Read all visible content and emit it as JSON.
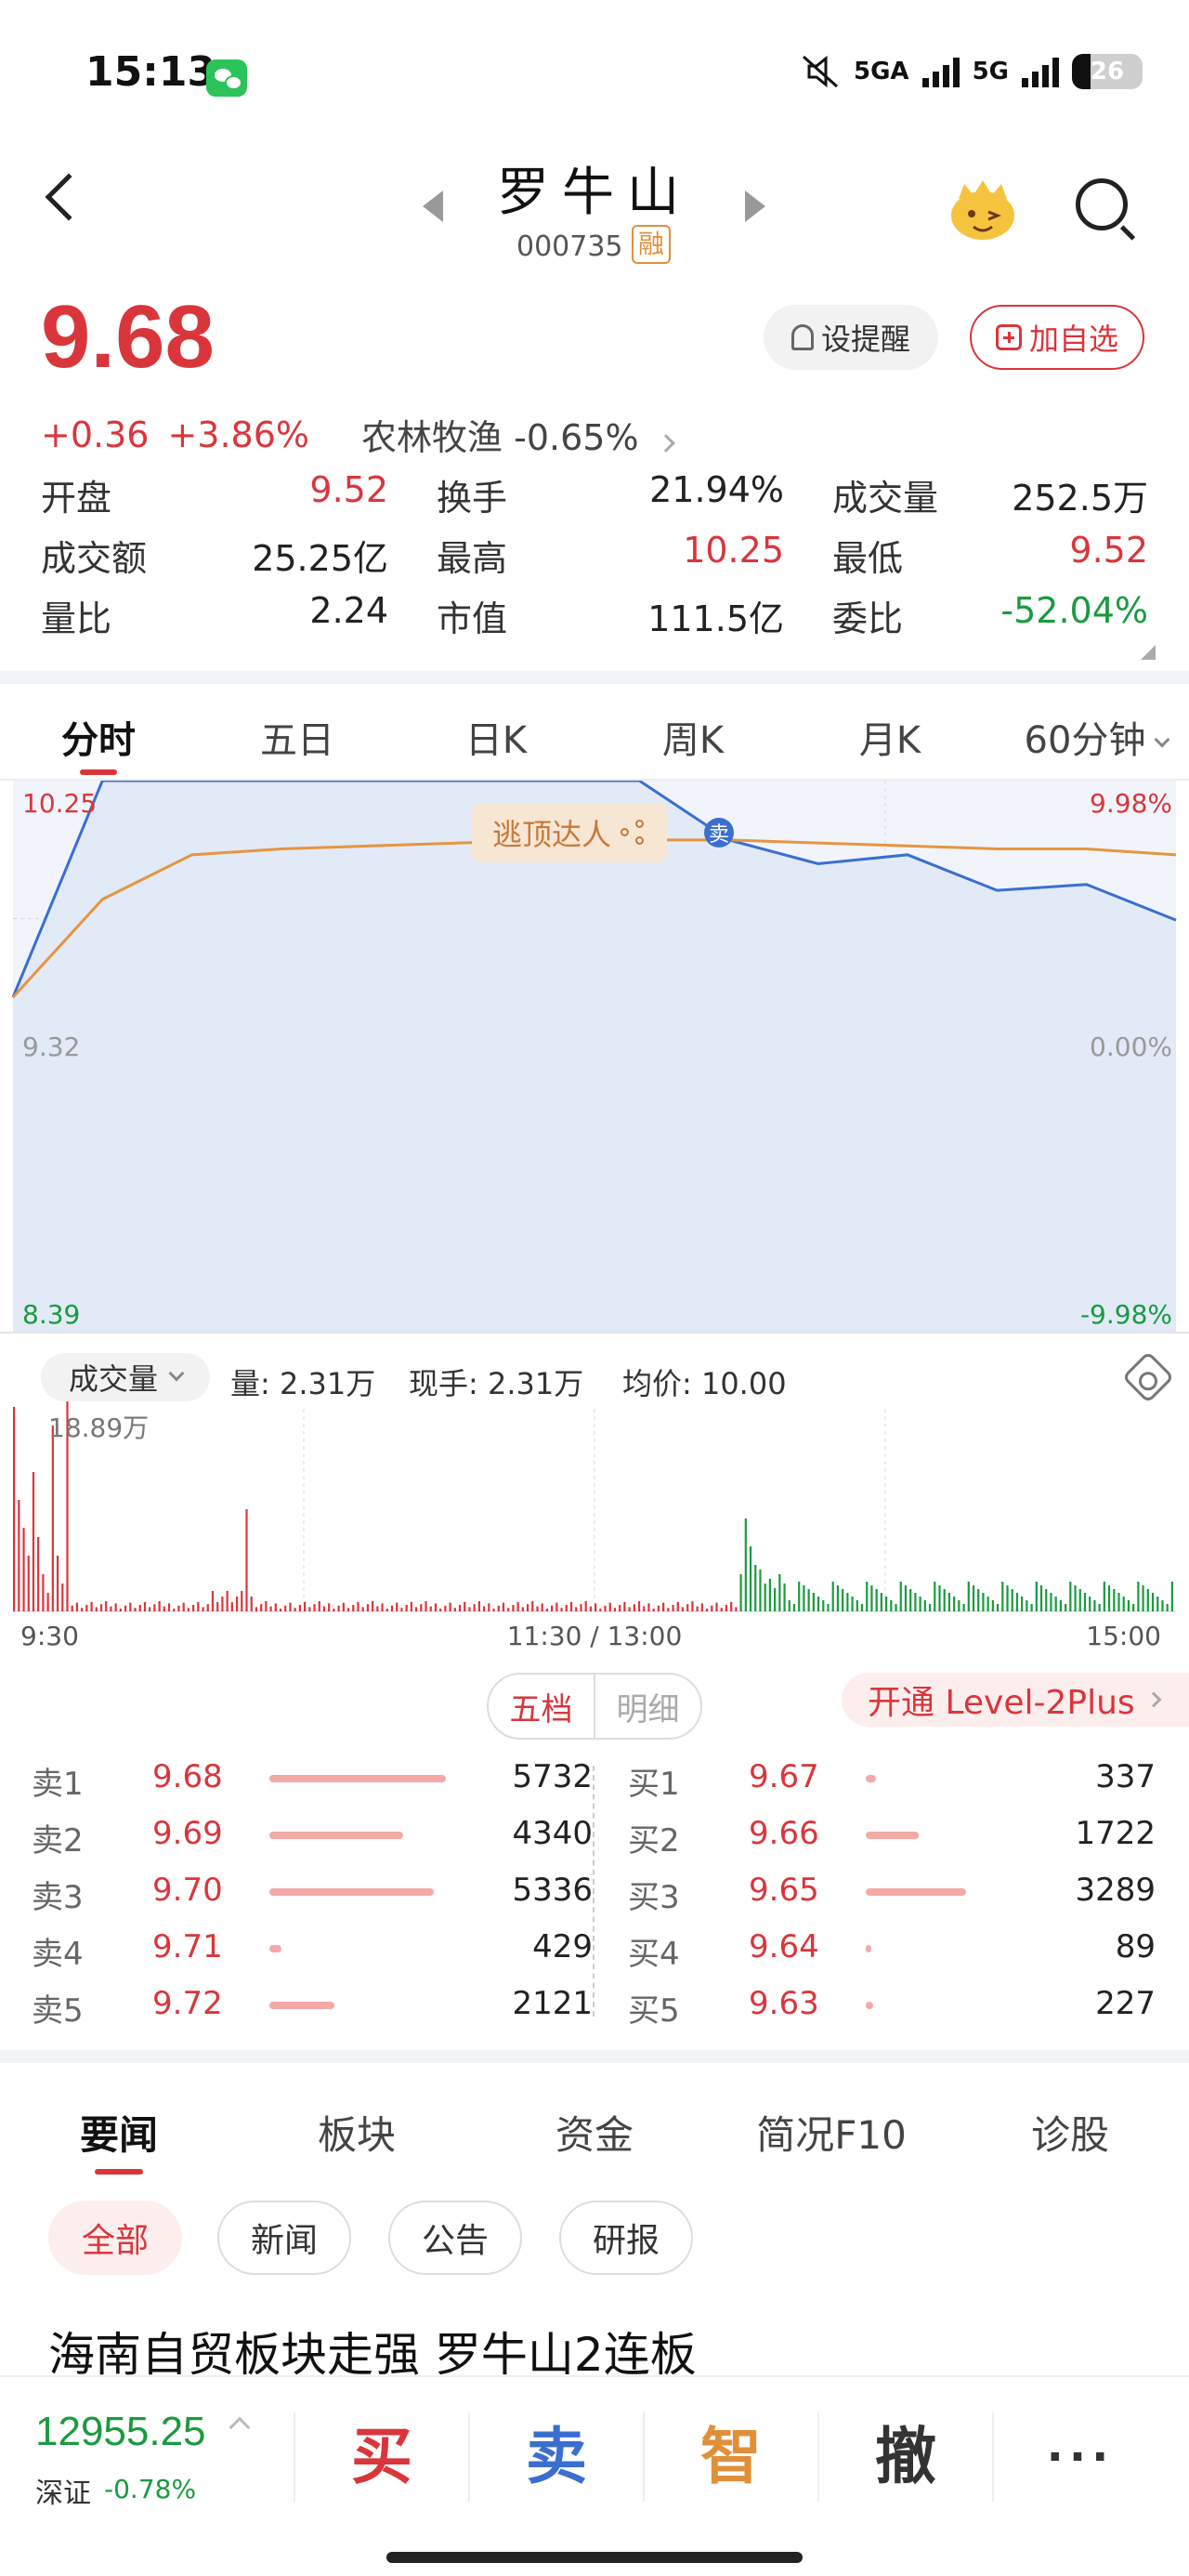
{
  "status_bar": {
    "time": "15:13",
    "network1": "5GA",
    "network2": "5G",
    "battery": "26"
  },
  "header": {
    "stock_name": "罗牛山",
    "stock_code": "000735",
    "margin_badge": "融"
  },
  "quote": {
    "price": "9.68",
    "change": "+0.36",
    "change_pct": "+3.86%",
    "sector_name": "农林牧渔",
    "sector_change": "-0.65%",
    "alert_label": "设提醒",
    "watchlist_label": "加自选",
    "stats": [
      [
        {
          "label": "开盘",
          "value": "9.52",
          "color": "red"
        },
        {
          "label": "换手",
          "value": "21.94%",
          "color": "black"
        },
        {
          "label": "成交量",
          "value": "252.5万",
          "color": "black"
        }
      ],
      [
        {
          "label": "成交额",
          "value": "25.25亿",
          "color": "black"
        },
        {
          "label": "最高",
          "value": "10.25",
          "color": "red"
        },
        {
          "label": "最低",
          "value": "9.52",
          "color": "red"
        }
      ],
      [
        {
          "label": "量比",
          "value": "2.24",
          "color": "black"
        },
        {
          "label": "市值",
          "value": "111.5亿",
          "color": "black"
        },
        {
          "label": "委比",
          "value": "-52.04%",
          "color": "green"
        }
      ]
    ]
  },
  "period_tabs": [
    "分时",
    "五日",
    "日K",
    "周K",
    "月K",
    "60分钟"
  ],
  "chart": {
    "price_high_label": "10.25",
    "price_mid_label": "9.32",
    "price_low_label": "8.39",
    "pct_high_label": "9.98%",
    "pct_mid_label": "0.00%",
    "pct_low_label": "-9.98%",
    "escape_tag": "逃顶达人",
    "sell_marker": "卖",
    "volume_selector": "成交量",
    "volume_text": "量: 2.31万",
    "current_hand": "现手: 2.31万",
    "avg_price": "均价: 10.00",
    "volume_max_label": "18.89万",
    "time_start": "9:30",
    "time_mid": "11:30 / 13:00",
    "time_end": "15:00",
    "colors": {
      "price_line": "#3a6fd0",
      "avg_line": "#e6953e",
      "up": "#d9363b",
      "down": "#1a9a3f"
    }
  },
  "chart_data": {
    "type": "line",
    "title": "",
    "xlabel": "",
    "ylabel": "",
    "ylim": [
      8.39,
      10.25
    ],
    "x": [
      "9:30",
      "9:35",
      "9:40",
      "10:00",
      "10:30",
      "11:00",
      "11:30/13:00",
      "13:10",
      "13:20",
      "13:40",
      "14:00",
      "14:20",
      "14:40",
      "15:00"
    ],
    "series": [
      {
        "values": [
          9.52,
          10.25,
          10.25,
          10.25,
          10.25,
          10.25,
          10.25,
          10.25,
          10.05,
          9.97,
          10.0,
          9.88,
          9.9,
          9.78
        ]
      },
      {
        "values": [
          9.52,
          9.85,
          10.0,
          10.02,
          10.03,
          10.04,
          10.05,
          10.05,
          10.05,
          10.04,
          10.03,
          10.02,
          10.02,
          10.0
        ]
      }
    ]
  },
  "orderbook": {
    "toggle_on": "五档",
    "toggle_off": "明细",
    "level2_banner": "开通 Level-2Plus",
    "sell": [
      {
        "level": "卖1",
        "price": "9.68",
        "qty": "5732",
        "ratio": 1.0
      },
      {
        "level": "卖2",
        "price": "9.69",
        "qty": "4340",
        "ratio": 0.76
      },
      {
        "level": "卖3",
        "price": "9.70",
        "qty": "5336",
        "ratio": 0.93
      },
      {
        "level": "卖4",
        "price": "9.71",
        "qty": "429",
        "ratio": 0.07
      },
      {
        "level": "卖5",
        "price": "9.72",
        "qty": "2121",
        "ratio": 0.37
      }
    ],
    "buy": [
      {
        "level": "买1",
        "price": "9.67",
        "qty": "337",
        "ratio": 0.06
      },
      {
        "level": "买2",
        "price": "9.66",
        "qty": "1722",
        "ratio": 0.3
      },
      {
        "level": "买3",
        "price": "9.65",
        "qty": "3289",
        "ratio": 0.57
      },
      {
        "level": "买4",
        "price": "9.64",
        "qty": "89",
        "ratio": 0.015
      },
      {
        "level": "买5",
        "price": "9.63",
        "qty": "227",
        "ratio": 0.04
      }
    ]
  },
  "news": {
    "tabs": [
      "要闻",
      "板块",
      "资金",
      "简况F10",
      "诊股"
    ],
    "chips": [
      "全部",
      "新闻",
      "公告",
      "研报"
    ],
    "headline": "海南自贸板块走强 罗牛山2连板"
  },
  "bottom_bar": {
    "index_value": "12955.25",
    "index_name": "深证",
    "index_change": "-0.78%",
    "buy_label": "买",
    "sell_label": "卖",
    "smart_label": "智",
    "cancel_label": "撤",
    "more_label": "···"
  }
}
